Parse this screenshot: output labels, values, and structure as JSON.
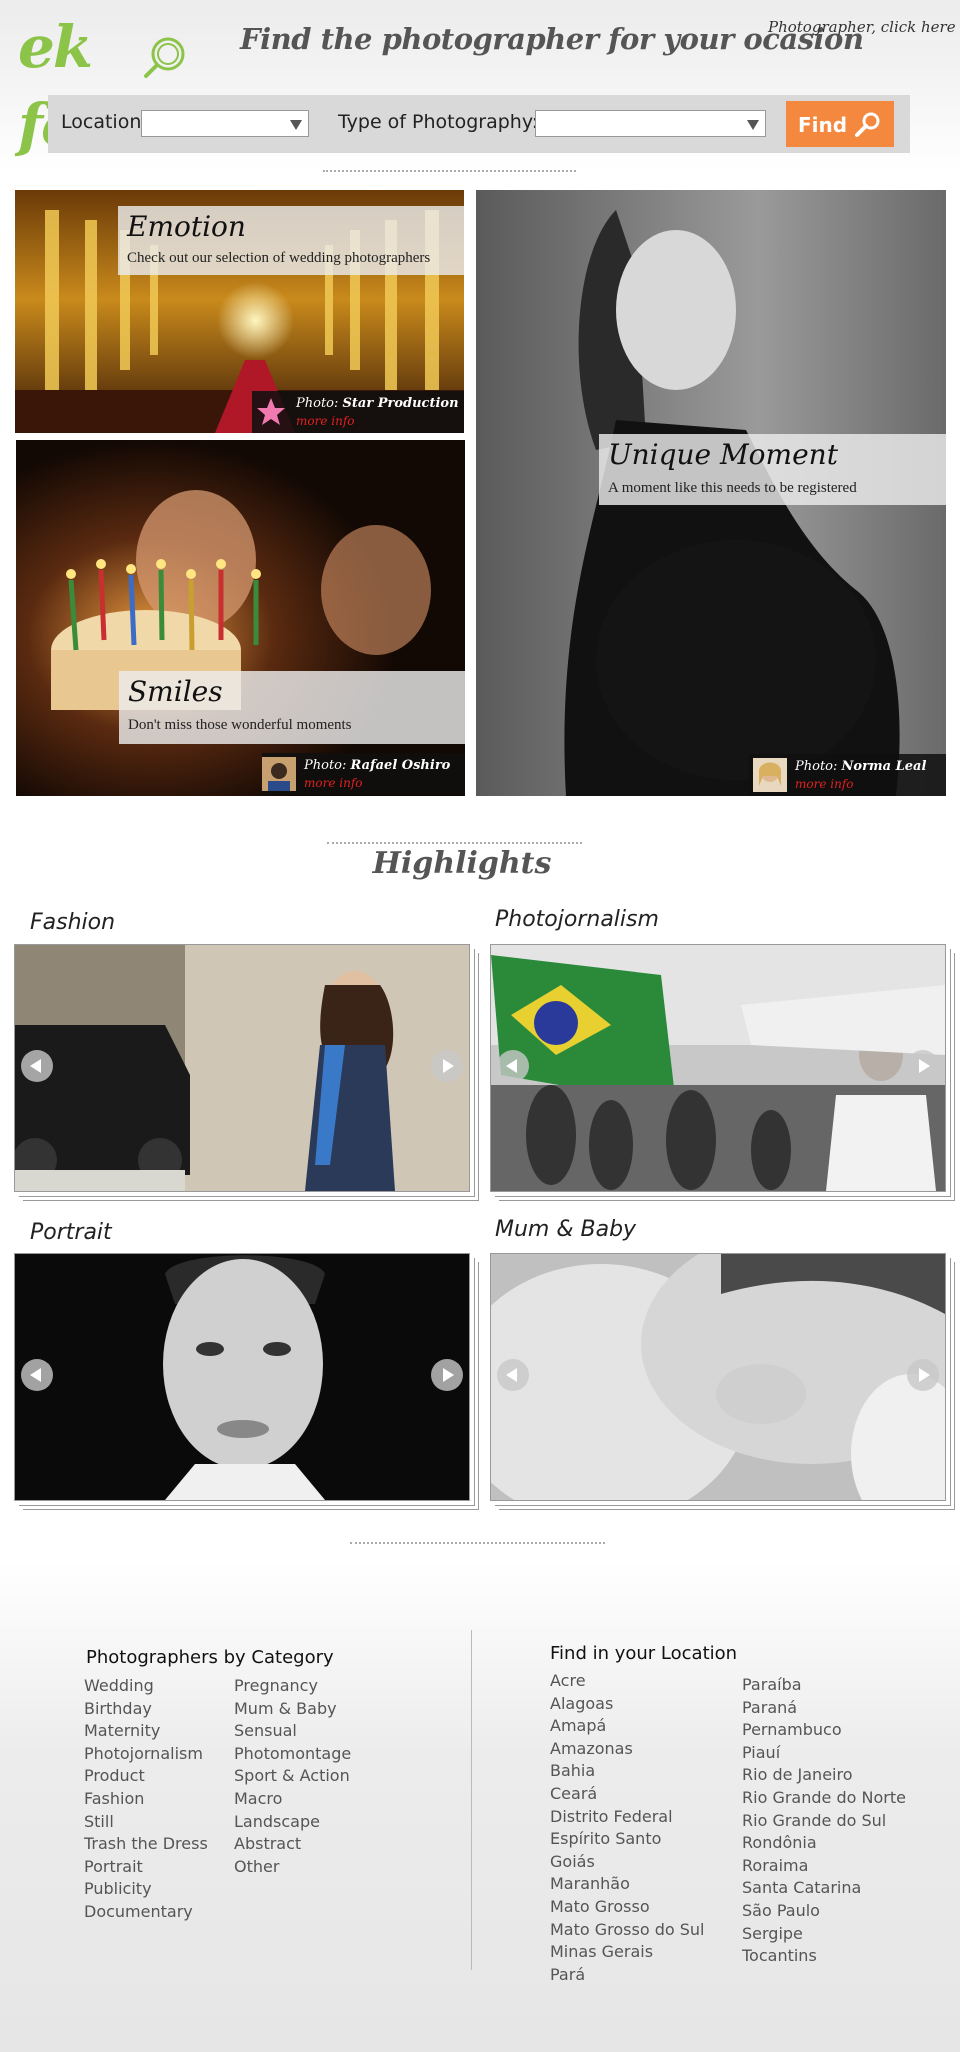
{
  "header": {
    "logo_text": "ek foto",
    "tagline": "Find the photographer for your ocasion",
    "photographer_link": "Photographer, click here"
  },
  "search": {
    "location_label": "Location:",
    "location_value": "",
    "type_label": "Type of Photography:",
    "type_value": "",
    "find_label": "Find"
  },
  "features": {
    "emotion": {
      "title": "Emotion",
      "subtitle": "Check out our selection of wedding photographers",
      "photo_prefix": "Photo: ",
      "photographer": "Star Production",
      "more_info": "more info"
    },
    "smiles": {
      "title": "Smiles",
      "subtitle": "Don't miss those wonderful moments",
      "photo_prefix": "Photo: ",
      "photographer": "Rafael Oshiro",
      "more_info": "more info"
    },
    "unique": {
      "title": "Unique Moment",
      "subtitle": "A moment like this needs to be registered",
      "photo_prefix": "Photo: ",
      "photographer": "Norma Leal",
      "more_info": "more info"
    }
  },
  "highlights": {
    "title": "Highlights",
    "items": [
      {
        "label": "Fashion"
      },
      {
        "label": "Photojornalism"
      },
      {
        "label": "Portrait"
      },
      {
        "label": "Mum & Baby"
      }
    ]
  },
  "footer": {
    "category_heading": "Photographers by Category",
    "categories_col1": [
      "Wedding",
      "Birthday",
      "Maternity",
      "Photojornalism",
      "Product",
      "Fashion",
      "Still",
      "Trash the Dress",
      "Portrait",
      "Publicity",
      "Documentary"
    ],
    "categories_col2": [
      "Pregnancy",
      "Mum & Baby",
      "Sensual",
      "Photomontage",
      "Sport & Action",
      "Macro",
      "Landscape",
      "Abstract",
      "Other"
    ],
    "location_heading": "Find in your Location",
    "locations_col1": [
      "Acre",
      "Alagoas",
      "Amapá",
      "Amazonas",
      "Bahia",
      "Ceará",
      "Distrito Federal",
      "Espírito Santo",
      "Goiás",
      "Maranhão",
      "Mato Grosso",
      "Mato Grosso do Sul",
      "Minas Gerais",
      "Pará"
    ],
    "locations_col2": [
      "Paraíba",
      "Paraná",
      "Pernambuco",
      "Piauí",
      "Rio de Janeiro",
      "Rio Grande do Norte",
      "Rio Grande do Sul",
      "Rondônia",
      "Roraima",
      "Santa Catarina",
      "São Paulo",
      "Sergipe",
      "Tocantins"
    ]
  },
  "colors": {
    "brand_green": "#8cc44a",
    "find_orange": "#f4883e",
    "more_info_red": "#e02020"
  }
}
